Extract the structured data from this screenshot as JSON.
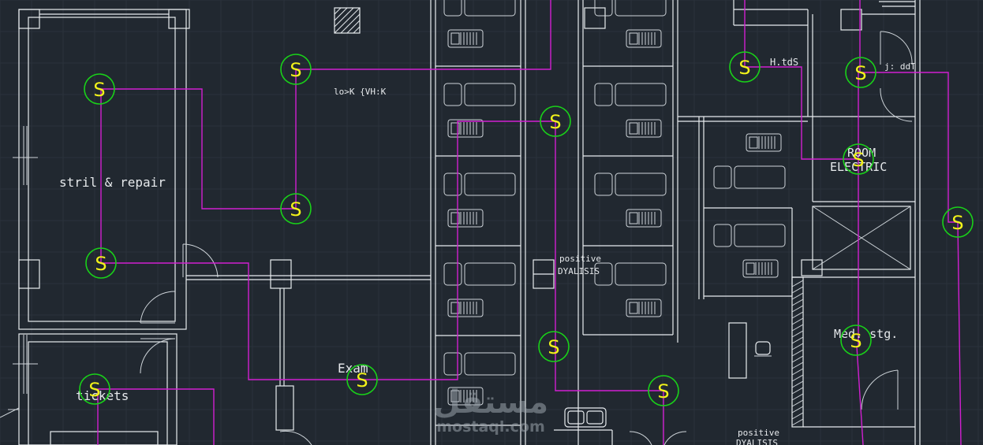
{
  "drawing": {
    "colors": {
      "background": "#212830",
      "walls": "#e8ecef",
      "wiring": "#d11fd1",
      "switch_circle": "#19d119",
      "switch_letter": "#f2f21a"
    },
    "switch_letter": "S",
    "switches_count": 14,
    "labels": {
      "stril_repair": "stril  &  repair",
      "tickets": "tickets",
      "exam": "Exam",
      "lok_vhk": "lo>K  {VH:K",
      "positive_1": "positive",
      "dyalisis_1": "DYALISIS",
      "h_tds": "H.tdS",
      "j_ddt": "j: ddT",
      "room": "ROOM",
      "electric": "ELECTRIC",
      "med_stg": "Med.  stg.",
      "positive_2": "positive",
      "dyalisis_2": "DYALISIS"
    },
    "watermark": {
      "arabic": "مستقل",
      "latin": "mostaql.com"
    }
  }
}
